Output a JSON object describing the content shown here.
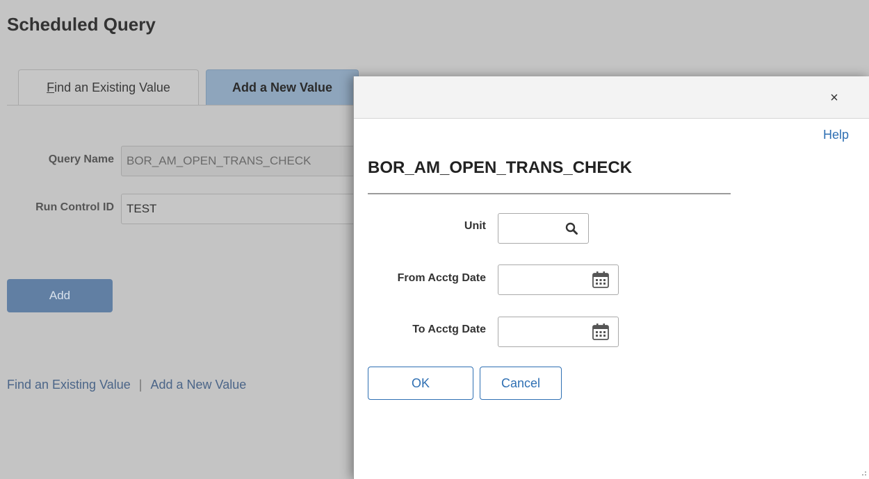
{
  "page": {
    "title": "Scheduled Query",
    "tabs": [
      {
        "label": "Find an Existing Value",
        "accesskey": "F"
      },
      {
        "label": "Add a New Value"
      }
    ],
    "fields": {
      "query_name": {
        "label": "Query Name",
        "value": "BOR_AM_OPEN_TRANS_CHECK"
      },
      "run_control_id": {
        "label": "Run Control ID",
        "value": "TEST"
      }
    },
    "add_button": "Add",
    "links": {
      "find": "Find an Existing Value",
      "separator": "|",
      "add": "Add a New Value"
    }
  },
  "modal": {
    "close_label": "×",
    "help_label": "Help",
    "title": "BOR_AM_OPEN_TRANS_CHECK",
    "fields": {
      "unit": {
        "label": "Unit",
        "value": ""
      },
      "from_acctg_date": {
        "label": "From Acctg Date",
        "value": ""
      },
      "to_acctg_date": {
        "label": "To Acctg Date",
        "value": ""
      }
    },
    "ok_label": "OK",
    "cancel_label": "Cancel"
  },
  "colors": {
    "link_blue": "#2e6fb3",
    "primary_button": "#617fa3",
    "overlay_gray": "#c4c4c4"
  },
  "icons": {
    "lookup": "search-icon",
    "date": "calendar-icon",
    "close": "close-icon"
  }
}
